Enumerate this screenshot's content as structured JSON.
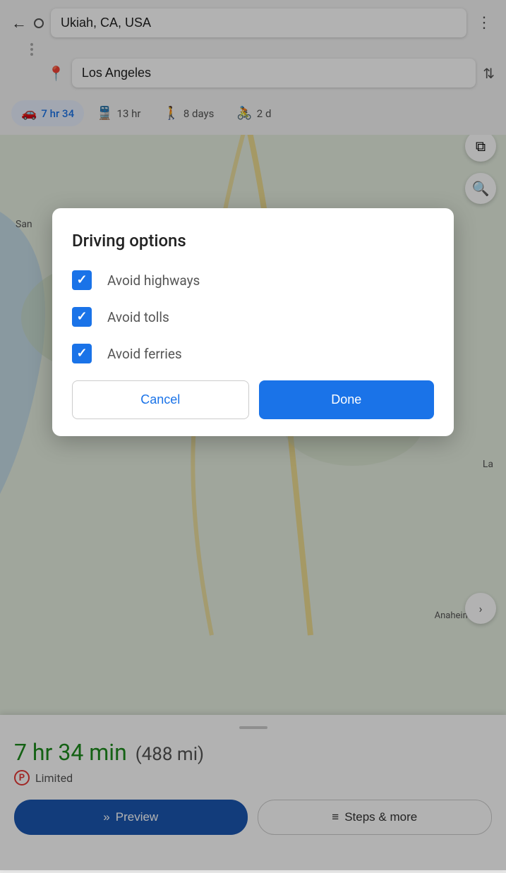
{
  "header": {
    "origin": "Ukiah, CA, USA",
    "destination": "Los Angeles",
    "back_icon": "←",
    "more_icon": "⋮",
    "swap_icon": "⇅"
  },
  "transport_tabs": [
    {
      "id": "drive",
      "icon": "🚗",
      "label": "7 hr 34",
      "active": true
    },
    {
      "id": "transit",
      "icon": "🚆",
      "label": "13 hr",
      "active": false
    },
    {
      "id": "walk",
      "icon": "🚶",
      "label": "8 days",
      "active": false
    },
    {
      "id": "bike",
      "icon": "🚴",
      "label": "2 d",
      "active": false
    }
  ],
  "map": {
    "label_san": "San",
    "label_la": "La",
    "label_anaheim": "Anaheim"
  },
  "bottom_sheet": {
    "time": "7 hr 34 min",
    "distance": "(488 mi)",
    "parking_label": "P",
    "limited_label": "Limited",
    "preview_label": "Preview",
    "steps_label": "Steps & more",
    "preview_icon": "»",
    "steps_icon": "≡"
  },
  "dialog": {
    "title": "Driving options",
    "options": [
      {
        "id": "highways",
        "label": "Avoid highways",
        "checked": true
      },
      {
        "id": "tolls",
        "label": "Avoid tolls",
        "checked": true
      },
      {
        "id": "ferries",
        "label": "Avoid ferries",
        "checked": true
      }
    ],
    "cancel_label": "Cancel",
    "done_label": "Done"
  },
  "icons": {
    "layers": "⧉",
    "search": "🔍",
    "chevron": "❯"
  }
}
